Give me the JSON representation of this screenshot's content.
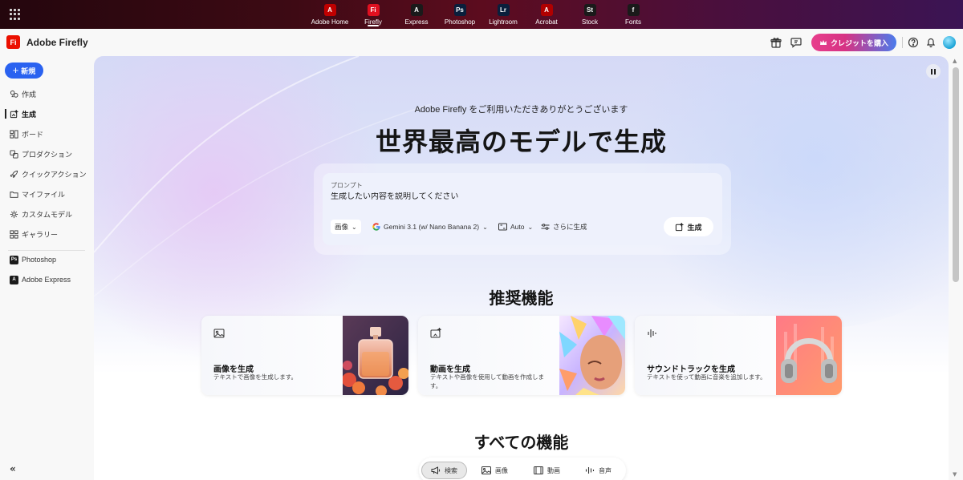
{
  "appbar": {
    "apps": [
      {
        "label": "Adobe Home",
        "logo": "A",
        "color": "#c00000",
        "icon": "adobe-logo-icon"
      },
      {
        "label": "Firefly",
        "logo": "Fi",
        "color": "#e01020",
        "icon": "firefly-logo-icon"
      },
      {
        "label": "Express",
        "logo": "A",
        "color": "#1a1a1a",
        "icon": "express-logo-icon"
      },
      {
        "label": "Photoshop",
        "logo": "Ps",
        "color": "#0a1f3c",
        "icon": "photoshop-logo-icon"
      },
      {
        "label": "Lightroom",
        "logo": "Lr",
        "color": "#0a1f3c",
        "icon": "lightroom-logo-icon"
      },
      {
        "label": "Acrobat",
        "logo": "A",
        "color": "#b00000",
        "icon": "acrobat-logo-icon"
      },
      {
        "label": "Stock",
        "logo": "St",
        "color": "#1a1a1a",
        "icon": "stock-logo-icon"
      },
      {
        "label": "Fonts",
        "logo": "f",
        "color": "#1a1a1a",
        "icon": "fonts-logo-icon"
      }
    ],
    "active_app": "Firefly"
  },
  "header": {
    "brand_logo": "Fi",
    "brand_name": "Adobe Firefly",
    "buy_credits_label": "クレジットを購入",
    "brand_color": "#eb1000"
  },
  "sidebar": {
    "new_label": "新規",
    "items": [
      {
        "label": "作成",
        "icon": "sparkle-icon"
      },
      {
        "label": "生成",
        "icon": "generate-icon",
        "active": true
      },
      {
        "label": "ボード",
        "icon": "board-icon"
      },
      {
        "label": "プロダクション",
        "icon": "production-icon"
      },
      {
        "label": "クイックアクション",
        "icon": "rocket-icon"
      },
      {
        "label": "マイファイル",
        "icon": "folder-icon"
      },
      {
        "label": "カスタムモデル",
        "icon": "custom-model-icon"
      },
      {
        "label": "ギャラリー",
        "icon": "gallery-icon"
      }
    ],
    "apps": [
      {
        "label": "Photoshop",
        "logo": "Ps"
      },
      {
        "label": "Adobe Express",
        "logo": "A"
      }
    ],
    "collapse_label": "«"
  },
  "main": {
    "welcome": "Adobe Firefly をご利用いただきありがとうございます",
    "hero": "世界最高のモデルで生成",
    "prompt": {
      "label": "プロンプト",
      "placeholder": "生成したい内容を説明してください",
      "type_chip": "画像",
      "model_chip": "Gemini 3.1 (w/ Nano Banana 2)",
      "aspect_chip": "Auto",
      "more_chip": "さらに生成",
      "generate_label": "生成"
    },
    "recommended_title": "推奨機能",
    "features": [
      {
        "title": "画像を生成",
        "desc": "テキストで画像を生成します。",
        "icon": "image-icon"
      },
      {
        "title": "動画を生成",
        "desc": "テキストや画像を使用して動画を作成します。",
        "icon": "video-sparkle-icon"
      },
      {
        "title": "サウンドトラックを生成",
        "desc": "テキストを使って動画に音楽を追加します。",
        "icon": "audio-wave-icon"
      }
    ],
    "all_title": "すべての機能",
    "tabs": [
      {
        "label": "検索",
        "icon": "megaphone-icon",
        "active": true
      },
      {
        "label": "画像",
        "icon": "image-icon"
      },
      {
        "label": "動画",
        "icon": "film-icon"
      },
      {
        "label": "音声",
        "icon": "audio-wave-icon"
      }
    ]
  }
}
